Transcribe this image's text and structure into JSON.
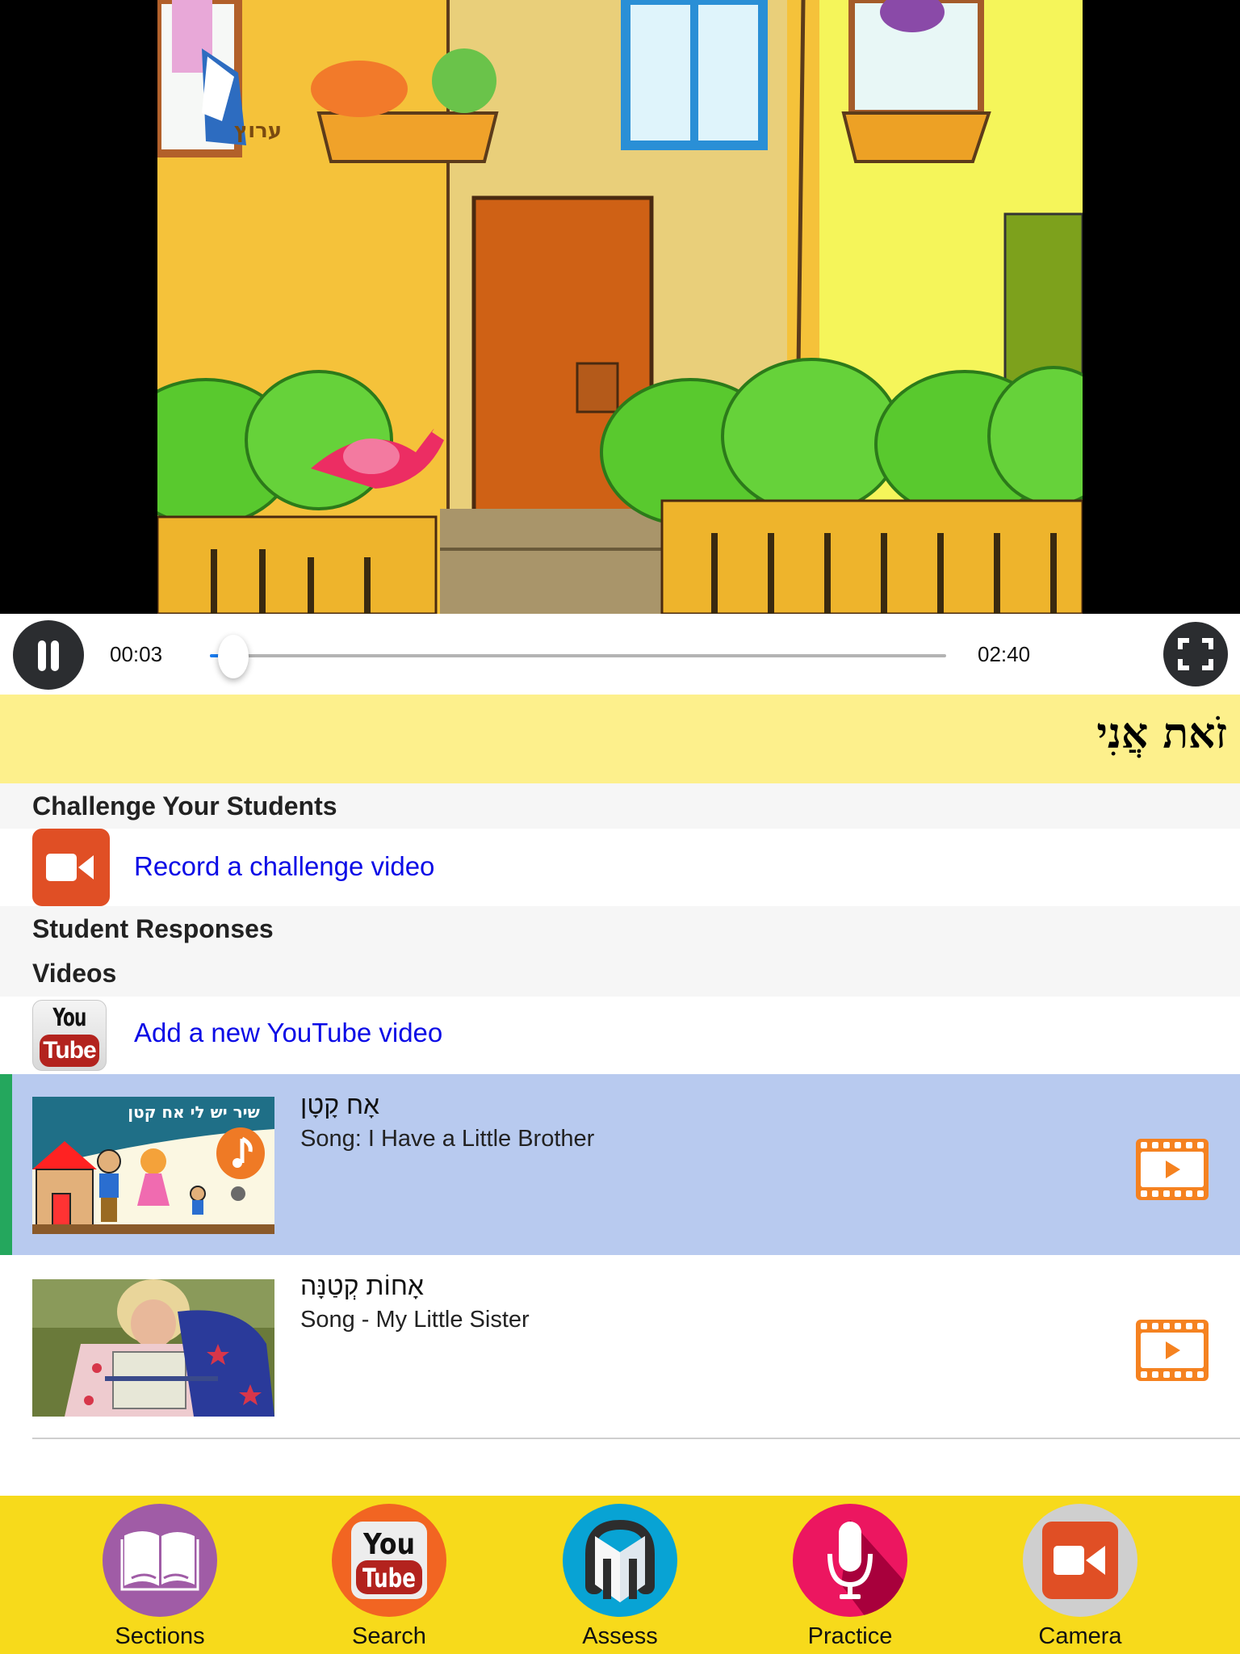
{
  "player": {
    "current_time": "00:03",
    "duration": "02:40",
    "progress_fraction": 0.0313,
    "pause_label": "Pause",
    "fullscreen_label": "Fullscreen"
  },
  "lesson": {
    "title": "זֹאת אֲנִי"
  },
  "challenge": {
    "header": "Challenge Your Students",
    "record_link": "Record a challenge video"
  },
  "responses": {
    "header": "Student Responses"
  },
  "videos": {
    "header": "Videos",
    "add_link": "Add a new YouTube video",
    "items": [
      {
        "hebrew_title": "אָח קָטָן",
        "english_title": "Song: I Have a Little Brother",
        "selected": true,
        "thumb_caption": "שיר יש לי אח קטן"
      },
      {
        "hebrew_title": "אָחוֹת קְטַנָּה",
        "english_title": "Song - My Little Sister",
        "selected": false
      }
    ]
  },
  "tabbar": {
    "items": [
      {
        "label": "Sections",
        "icon": "book-icon",
        "color": "#a05ca6"
      },
      {
        "label": "Search",
        "icon": "youtube-icon",
        "color": "#f26522"
      },
      {
        "label": "Assess",
        "icon": "headphones-icon",
        "color": "#08a3d4"
      },
      {
        "label": "Practice",
        "icon": "microphone-icon",
        "color": "#ec1660"
      },
      {
        "label": "Camera",
        "icon": "video-camera-icon",
        "color": "#cfcfcf"
      }
    ]
  },
  "colors": {
    "accent_link": "#0b0be6",
    "selected_row": "#b8caef",
    "selected_indicator": "#24a75d",
    "title_bar": "#fdf08c",
    "tabbar": "#f7da1b",
    "film_icon": "#f58220"
  }
}
